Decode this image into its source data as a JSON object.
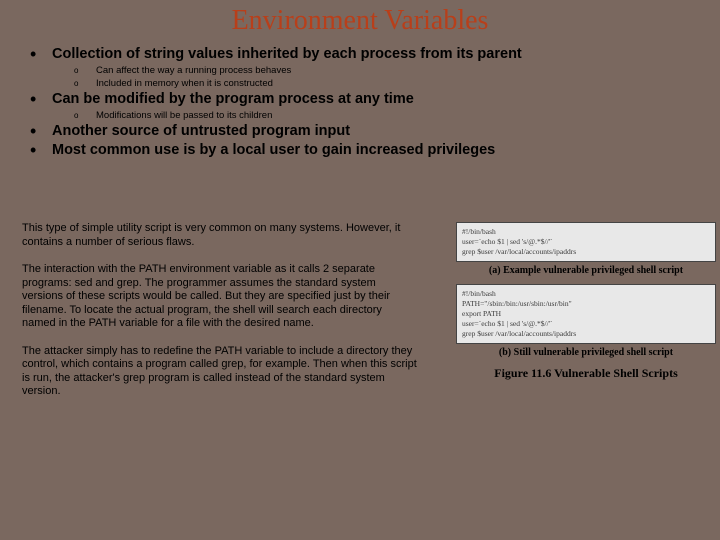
{
  "title": "Environment Variables",
  "bullets": [
    {
      "text": "Collection of string values inherited by each process from its parent",
      "sub": [
        "Can affect the way a running process behaves",
        "Included in memory when it is constructed"
      ]
    },
    {
      "text": "Can be modified by the program process at any time",
      "sub": [
        "Modifications will be passed to its children"
      ]
    },
    {
      "text": "Another source of untrusted program input",
      "sub": []
    },
    {
      "text": "Most common use is by a local user to gain increased privileges",
      "sub": []
    }
  ],
  "paragraphs": [
    "This type of simple utility script is very common on many systems. However, it contains a number of serious flaws.",
    "The interaction with the PATH environment variable as it calls 2 separate programs: sed and grep. The programmer assumes the standard system versions of these scripts would be called. But they are specified just by their filename. To locate the actual program, the shell will search each directory named in the PATH variable for a file with the desired name.",
    "The attacker simply has to redefine the PATH variable to include a directory they control, which contains a program called grep, for example. Then when this script is run, the attacker's grep program is called instead of the standard system version."
  ],
  "figure": {
    "code_a": "#!/bin/bash\nuser=`echo $1 | sed 's/@.*$//'`\ngrep $user /var/local/accounts/ipaddrs",
    "caption_a": "(a) Example vulnerable privileged shell script",
    "code_b": "#!/bin/bash\nPATH=\"/sbin:/bin:/usr/sbin:/usr/bin\"\nexport PATH\nuser=`echo $1 | sed 's/@.*$//'`\ngrep $user /var/local/accounts/ipaddrs",
    "caption_b": "(b) Still vulnerable privileged shell script",
    "title": "Figure 11.6  Vulnerable Shell Scripts"
  }
}
